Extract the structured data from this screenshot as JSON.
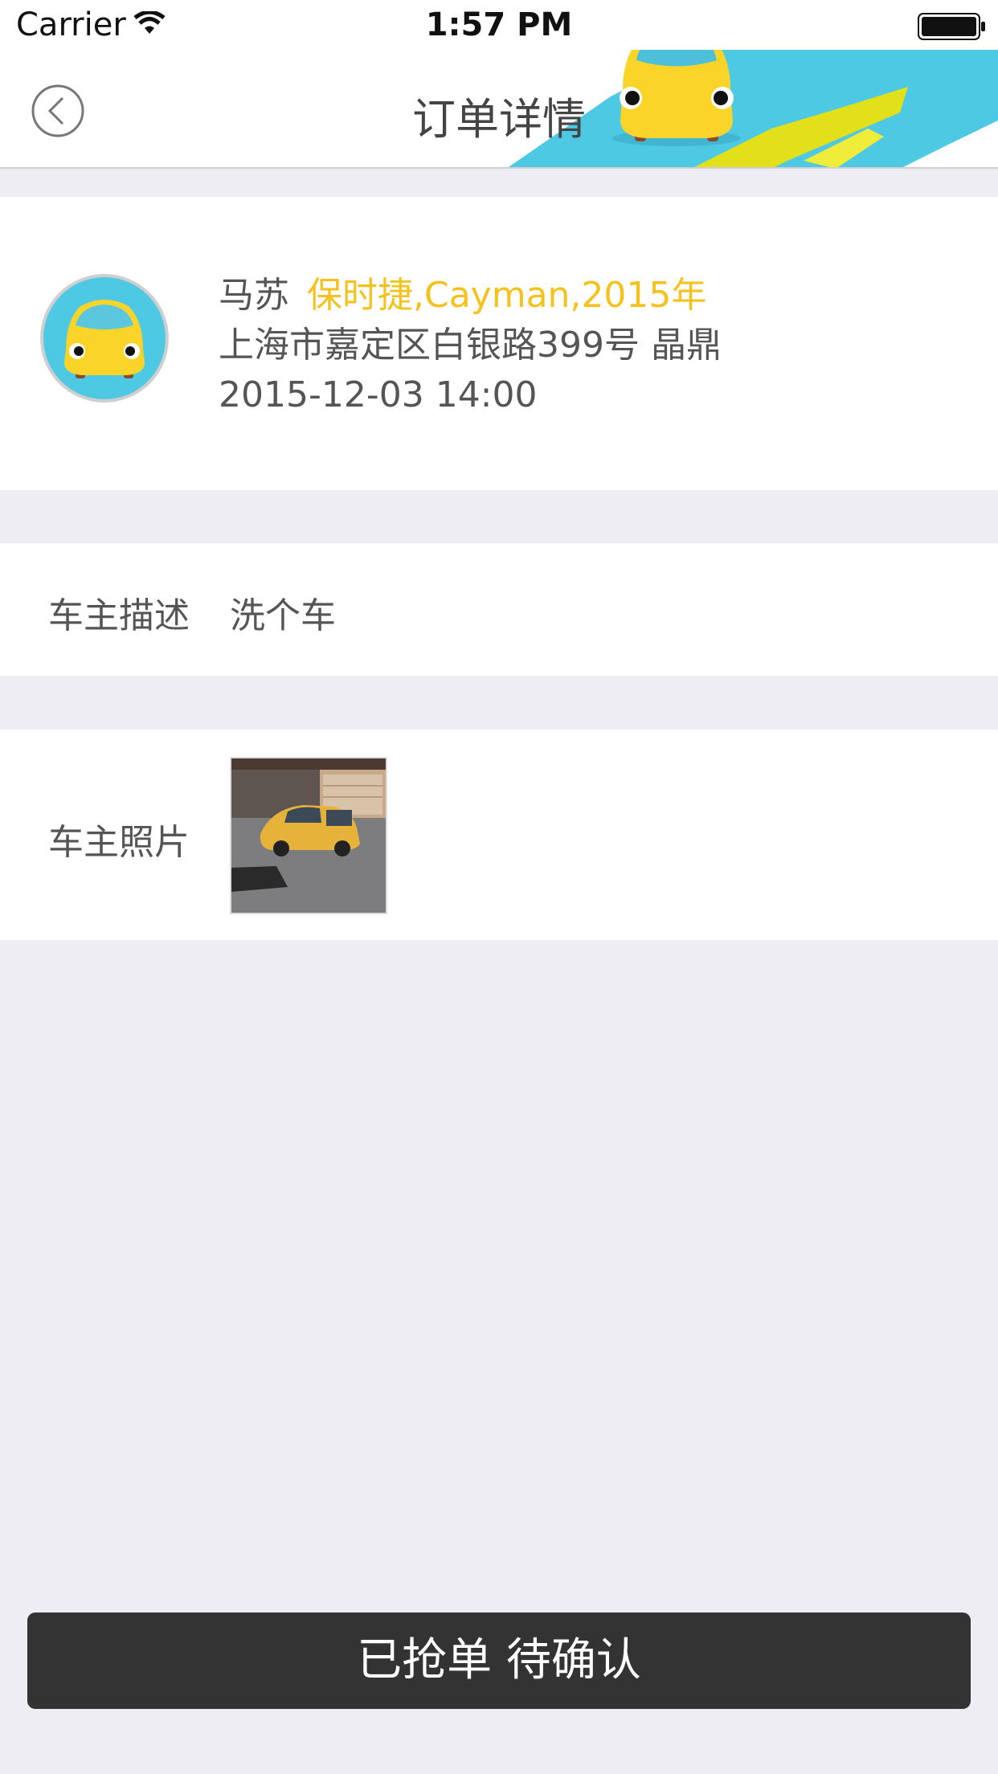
{
  "status_bar": {
    "carrier": "Carrier",
    "time": "1:57 PM",
    "wifi_icon": "wifi-icon",
    "battery_icon": "battery-icon"
  },
  "nav": {
    "title": "订单详情",
    "back_icon": "back-chevron-icon",
    "decoration": "car-mascot-illustration"
  },
  "customer": {
    "name": "马苏",
    "car_model": "保时捷,Cayman,2015年",
    "address": "上海市嘉定区白银路399号 晶鼎",
    "datetime": "2015-12-03 14:00",
    "avatar_icon": "car-avatar-icon"
  },
  "description": {
    "label": "车主描述",
    "value": "洗个车"
  },
  "photos": {
    "label": "车主照片",
    "items": [
      "yellow-hatchback-photo"
    ]
  },
  "action": {
    "button_label": "已抢单 待确认"
  },
  "colors": {
    "accent_yellow": "#f5c21d",
    "accent_blue": "#4dc9e4",
    "background": "#efedf4",
    "button_dark": "#333333"
  }
}
